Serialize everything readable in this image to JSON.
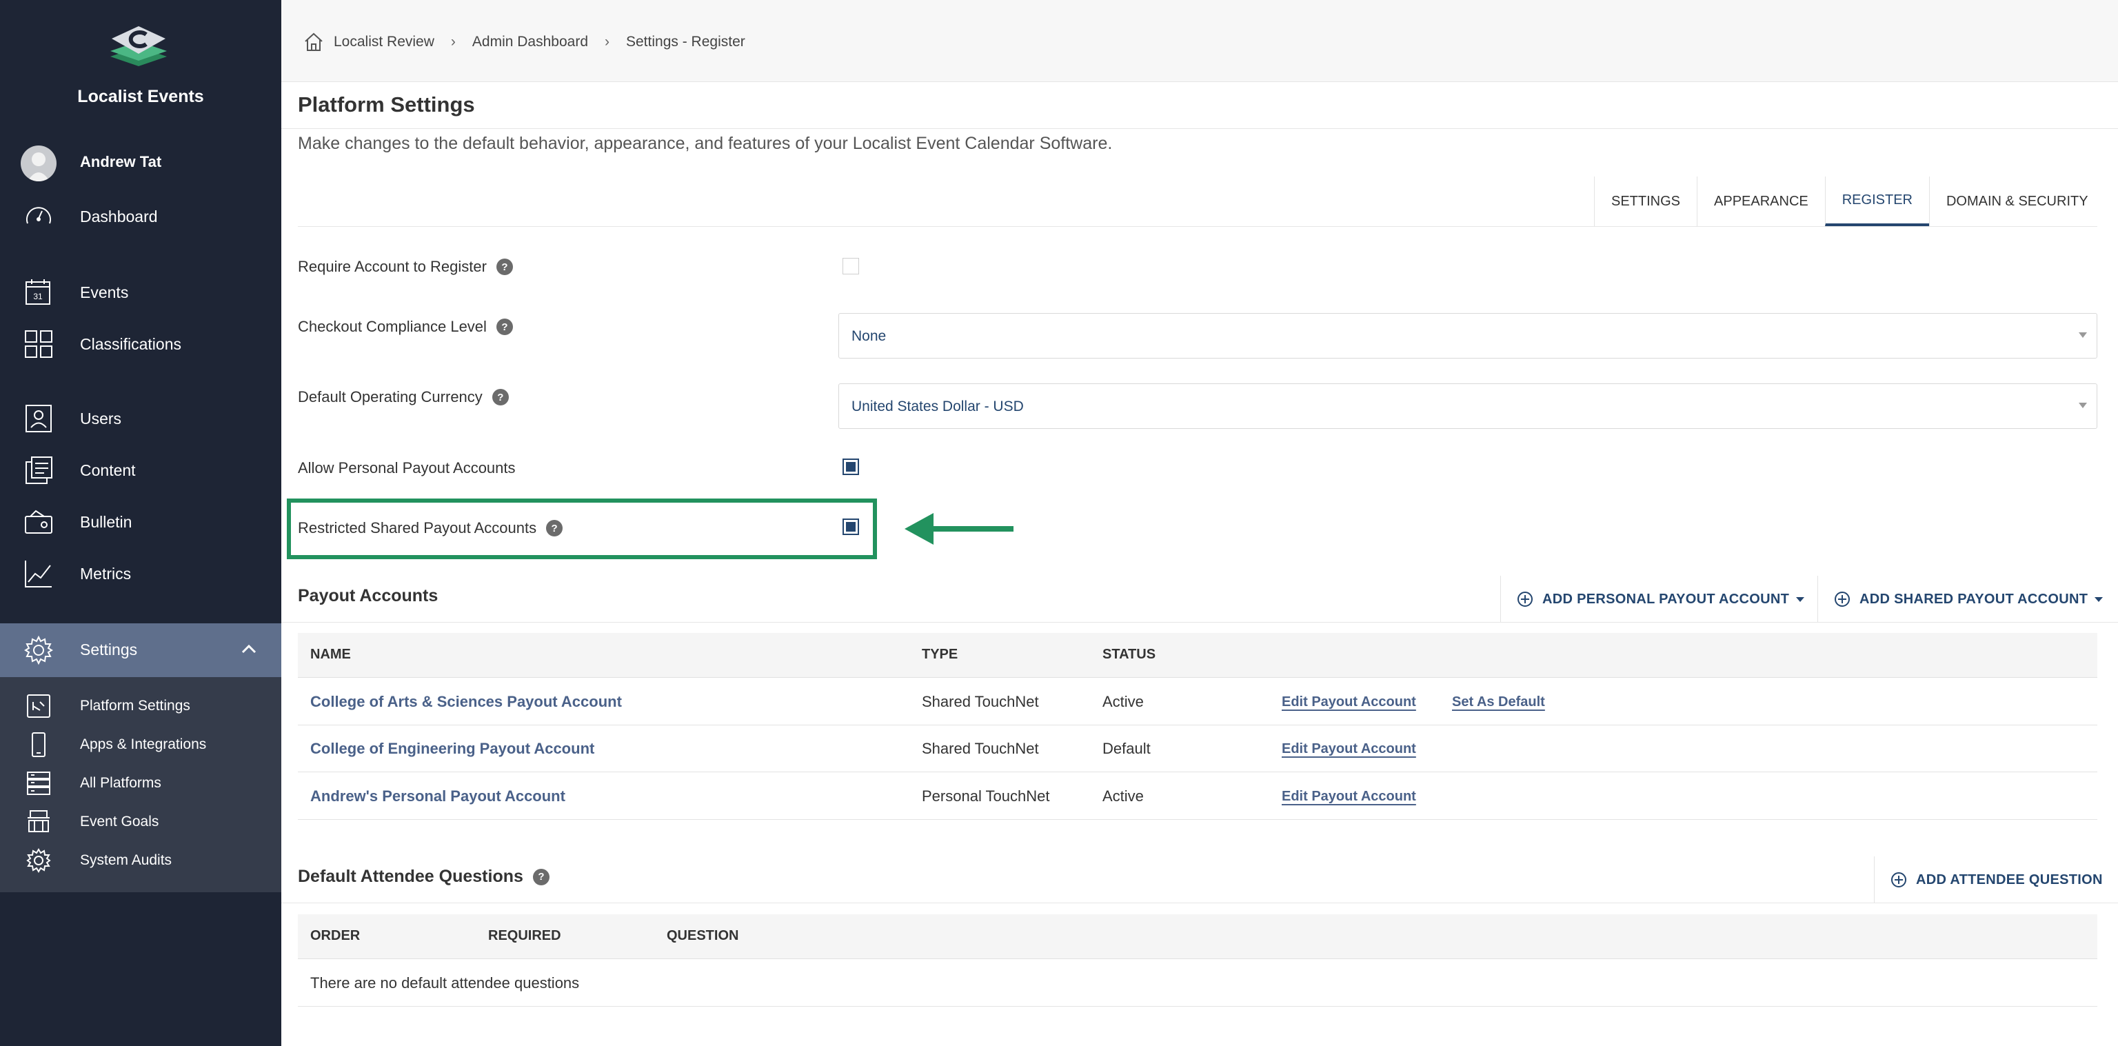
{
  "app": {
    "org_name": "Localist Events",
    "user_name": "Andrew Tat"
  },
  "sidebar": {
    "items": [
      {
        "label": "Dashboard",
        "icon": "gauge-icon"
      },
      {
        "label": "Events",
        "icon": "calendar-icon",
        "icon_text": "31"
      },
      {
        "label": "Classifications",
        "icon": "grid-icon"
      },
      {
        "label": "Users",
        "icon": "user-icon"
      },
      {
        "label": "Content",
        "icon": "content-icon"
      },
      {
        "label": "Bulletin",
        "icon": "bulletin-icon"
      },
      {
        "label": "Metrics",
        "icon": "chart-line-icon"
      },
      {
        "label": "Settings",
        "icon": "gear-icon"
      }
    ],
    "submenu": [
      {
        "label": "Platform Settings",
        "icon": "platform-settings-icon"
      },
      {
        "label": "Apps & Integrations",
        "icon": "phone-icon"
      },
      {
        "label": "All Platforms",
        "icon": "server-icon"
      },
      {
        "label": "Event Goals",
        "icon": "goals-icon"
      },
      {
        "label": "System Audits",
        "icon": "gear-small-icon"
      }
    ]
  },
  "breadcrumb": [
    "Localist Review",
    "Admin Dashboard",
    "Settings - Register"
  ],
  "page": {
    "title": "Platform Settings",
    "description": "Make changes to the default behavior, appearance, and features of your Localist Event Calendar Software."
  },
  "tabs": [
    {
      "label": "SETTINGS",
      "active": false
    },
    {
      "label": "APPEARANCE",
      "active": false
    },
    {
      "label": "REGISTER",
      "active": true
    },
    {
      "label": "DOMAIN & SECURITY",
      "active": false
    }
  ],
  "form": {
    "require_account": {
      "label": "Require Account to Register",
      "checked": false
    },
    "compliance": {
      "label": "Checkout Compliance Level",
      "value": "None"
    },
    "currency": {
      "label": "Default Operating Currency",
      "value": "United States Dollar - USD"
    },
    "personal_payout": {
      "label": "Allow Personal Payout Accounts",
      "checked": true
    },
    "restricted_shared": {
      "label": "Restricted Shared Payout Accounts",
      "checked": true
    }
  },
  "help_glyph": "?",
  "payout": {
    "title": "Payout Accounts",
    "add_personal": "ADD PERSONAL PAYOUT ACCOUNT",
    "add_shared": "ADD SHARED PAYOUT ACCOUNT",
    "columns": [
      "NAME",
      "TYPE",
      "STATUS"
    ],
    "rows": [
      {
        "name": "College of Arts & Sciences Payout Account",
        "type": "Shared TouchNet",
        "status": "Active",
        "edit": "Edit Payout Account",
        "default": "Set As Default"
      },
      {
        "name": "College of Engineering Payout Account",
        "type": "Shared TouchNet",
        "status": "Default",
        "edit": "Edit Payout Account"
      },
      {
        "name": "Andrew's Personal Payout Account",
        "type": "Personal TouchNet",
        "status": "Active",
        "edit": "Edit Payout Account"
      }
    ]
  },
  "attendee": {
    "title": "Default Attendee Questions",
    "add": "ADD ATTENDEE QUESTION",
    "columns": [
      "ORDER",
      "REQUIRED",
      "QUESTION"
    ],
    "empty": "There are no default attendee questions"
  },
  "colors": {
    "sidebar_bg": "#1e2535",
    "accent": "#24466f",
    "link": "#4a6189",
    "highlight": "#22925e"
  }
}
